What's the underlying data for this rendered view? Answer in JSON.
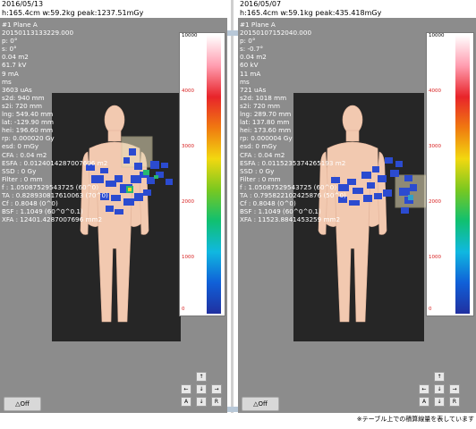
{
  "panels": [
    {
      "date": "2016/05/13",
      "summary": "h:165.4cm w:59.2kg peak:1237.51mGy",
      "info": [
        "#1 Plane A",
        "20150113133229.000",
        "p: 0°",
        "s: 0°",
        "0.04 m2",
        "61.7 kV",
        "9 mA",
        " ms",
        "3603 uAs",
        "s2d: 940 mm",
        "s2i: 720 mm",
        "lng: 549.40 mm",
        "lat: -129.90 mm",
        "hei: 196.60 mm",
        "rp: 0.000020 Gy",
        "esd: 0 mGy",
        "CFA : 0.04 m2",
        "ESFA : 0.0124014287007696 m2",
        "SSD : 0 Gy",
        "Filter : 0 mm",
        "f : 1.05087529543725 (60^0)",
        "TA : 0.828930817610063 (70^0)",
        "Cf : 0.8048 (0^0)",
        "BSF : 1.1049 (60^0^0.1)",
        "XFA : 12401.4287007696 mm2"
      ],
      "off_label": "△Off"
    },
    {
      "date": "2016/05/07",
      "summary": "h:165.4cm w:59.1kg peak:435.418mGy",
      "info": [
        "#1 Plane A",
        "20150107152040.000",
        "p: 0°",
        "s: -0.7°",
        "0.04 m2",
        "60 kV",
        "11 mA",
        " ms",
        "721 uAs",
        "s2d: 1018 mm",
        "s2i: 720 mm",
        "lng: 289.70 mm",
        "lat: 137.80 mm",
        "hei: 173.60 mm",
        "rp: 0.000004 Gy",
        "esd: 0 mGy",
        "CFA : 0.04 m2",
        "ESFA : 0.0115235374265193 m2",
        "SSD : 0 Gy",
        "Filter : 0 mm",
        "f : 1.05087529543725 (60^0)",
        "TA : 0.795822102425876 (50^0)",
        "Cf : 0.8048 (0^0)",
        "BSF : 1.1049 (60^0^0.1)",
        "XFA : 11523.8841453259 mm2"
      ],
      "off_label": "△Off"
    }
  ],
  "color_scale": {
    "ticks": [
      "10000",
      "4000",
      "3000",
      "2000",
      "1000",
      "0"
    ],
    "stops": [
      "#ffffff",
      "#ff9db0",
      "#e8242a",
      "#f07a10",
      "#f2d810",
      "#7ac820",
      "#10c070",
      "#10b8e0",
      "#1060d8",
      "#2030a0"
    ]
  },
  "nav_buttons": {
    "up": "↑",
    "left": "←",
    "down": "↓",
    "right": "→",
    "a": "A",
    "l_down": "↓",
    "r": "R"
  },
  "footer_note": "※テーブル上での積算線量を表しています"
}
